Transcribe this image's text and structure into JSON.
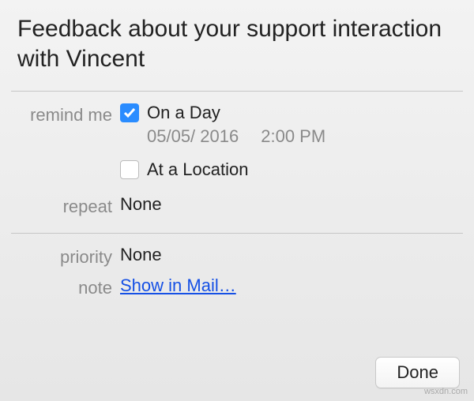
{
  "title": "Feedback about your support interaction with Vincent",
  "labels": {
    "remind_me": "remind me",
    "repeat": "repeat",
    "priority": "priority",
    "note": "note"
  },
  "remind": {
    "on_a_day": {
      "label": "On a Day",
      "checked": true,
      "date": "05/05/ 2016",
      "time": "2:00 PM"
    },
    "at_a_location": {
      "label": "At a Location",
      "checked": false
    }
  },
  "repeat_value": "None",
  "priority_value": "None",
  "note_link": "Show in Mail…",
  "done_button": "Done",
  "watermark": "wsxdn.com"
}
